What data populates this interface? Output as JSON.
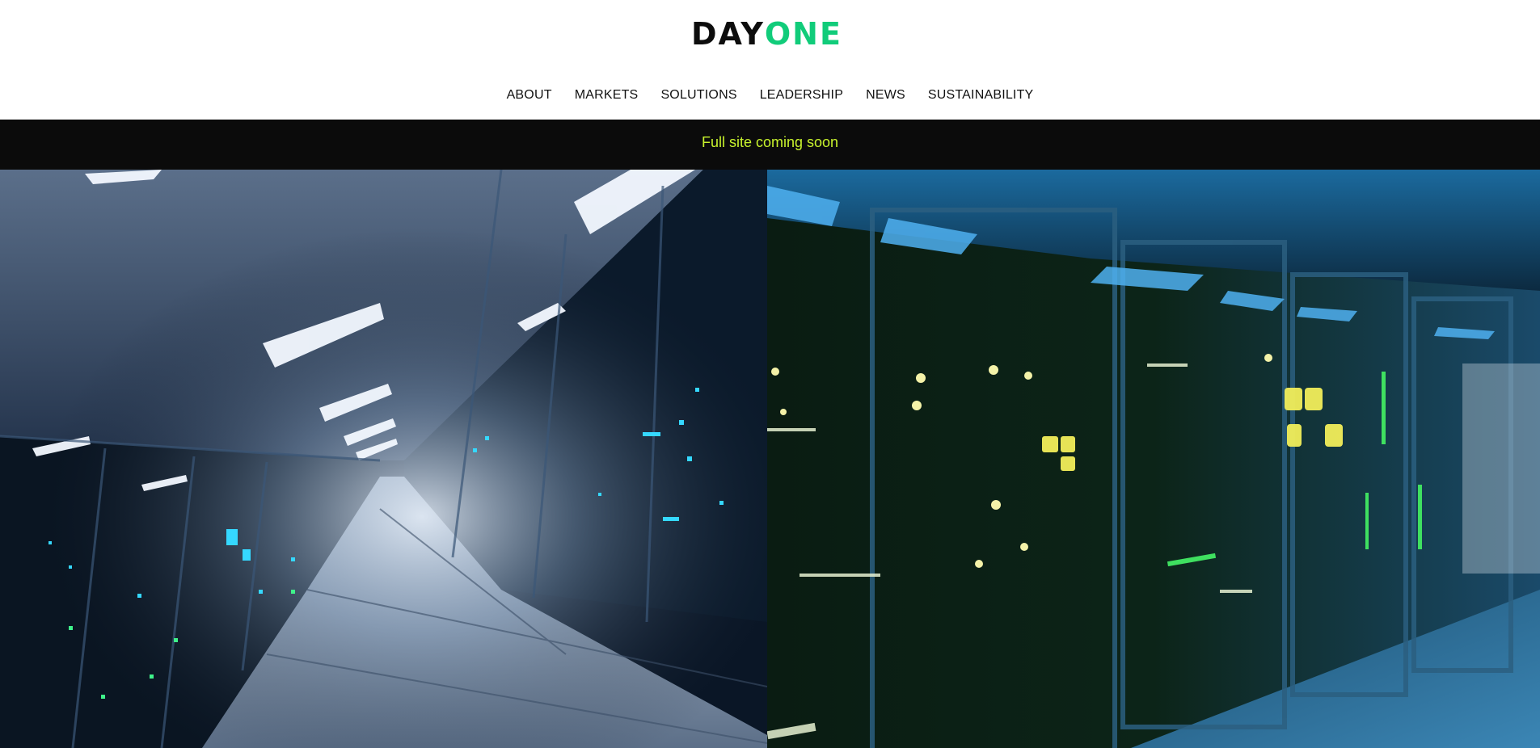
{
  "brand": {
    "logo_part1": "DAY",
    "logo_part2": "ONE",
    "logo_colors": {
      "part1": "#0d0d0d",
      "part2": "#11cc7a"
    }
  },
  "nav": {
    "items": [
      {
        "label": "ABOUT"
      },
      {
        "label": "MARKETS"
      },
      {
        "label": "SOLUTIONS"
      },
      {
        "label": "LEADERSHIP"
      },
      {
        "label": "NEWS"
      },
      {
        "label": "SUSTAINABILITY"
      }
    ]
  },
  "banner": {
    "text": "Full site coming soon",
    "background": "#0b0b0b",
    "text_color": "#c8f22d"
  }
}
